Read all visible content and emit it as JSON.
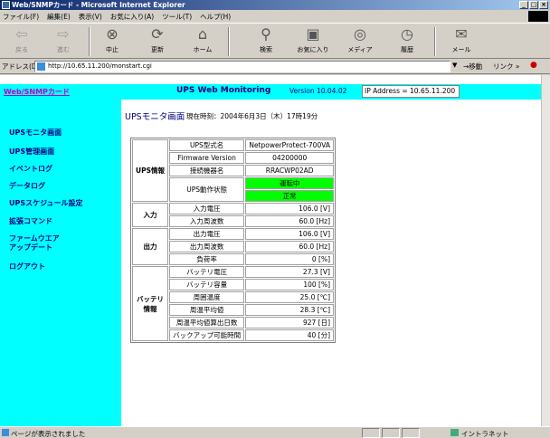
{
  "window": {
    "title": "Web/SNMPカード - Microsoft Internet Explorer",
    "buttons": [
      "_",
      "□",
      "×"
    ]
  },
  "menubar": [
    "ファイル(F)",
    "編集(E)",
    "表示(V)",
    "お気に入り(A)",
    "ツール(T)",
    "ヘルプ(H)"
  ],
  "toolbar": {
    "back": "戻る",
    "forward": "進む",
    "stop": "中止",
    "refresh": "更新",
    "home": "ホーム",
    "search": "検索",
    "favorites": "お気に入り",
    "media": "メディア",
    "history": "履歴",
    "mail": "メール"
  },
  "address": {
    "label": "アドレス(D)",
    "url": "http://10.65.11.200/monstart.cgi",
    "go": "移動",
    "links": "リンク »"
  },
  "header": {
    "brand": "Web/SNMPカード",
    "title": "UPS Web Monitoring",
    "version": "Version 10.04.02",
    "ip": "IP Address = 10.65.11.200"
  },
  "sidebar": {
    "items": [
      "UPSモニタ画面",
      "UPS管理画面",
      "イベントログ",
      "データログ",
      "UPSスケジュール設定",
      "拡張コマンド",
      "ファームウエア\nアップデート",
      "ログアウト"
    ]
  },
  "page": {
    "title": "UPSモニタ画面",
    "time": "現在時刻：2004年6月3日（木）17時19分"
  },
  "table": {
    "ups_info": {
      "section": "UPS情報",
      "model_label": "UPS型式名",
      "model_value": "NetpowerProtect-700VA",
      "fw_label": "Firmware Version",
      "fw_value": "04200000",
      "device_label": "接続機器名",
      "device_value": "RRACWP02AD",
      "status_label": "UPS動作状態",
      "status_value1": "運転中",
      "status_value2": "正常"
    },
    "input": {
      "section": "入力",
      "voltage_label": "入力電圧",
      "voltage_value": "106.0 [V]",
      "freq_label": "入力周波数",
      "freq_value": "60.0 [Hz]"
    },
    "output": {
      "section": "出力",
      "voltage_label": "出力電圧",
      "voltage_value": "106.0 [V]",
      "freq_label": "出力周波数",
      "freq_value": "60.0 [Hz]",
      "load_label": "負荷率",
      "load_value": "0 [%]"
    },
    "battery": {
      "section": "バッテリ\n情報",
      "voltage_label": "バッテリ電圧",
      "voltage_value": "27.3 [V]",
      "capacity_label": "バッテリ容量",
      "capacity_value": "100 [%]",
      "temp_label": "周囲温度",
      "temp_value": "25.0 [℃]",
      "avgtemp_label": "周温平均値",
      "avgtemp_value": "28.3 [℃]",
      "avgdays_label": "周温平均値算出日数",
      "avgdays_value": "927 [日]",
      "backup_label": "バックアップ可能時間",
      "backup_value": "40 [分]"
    }
  },
  "statusbar": {
    "message": "ページが表示されました",
    "zone": "イントラネット"
  }
}
